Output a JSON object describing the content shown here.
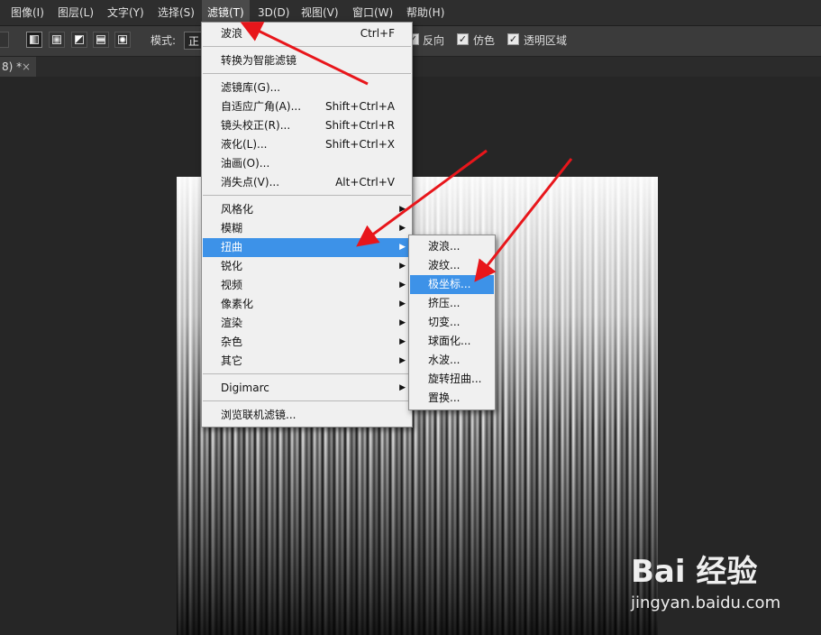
{
  "menubar": {
    "items": [
      "图像(I)",
      "图层(L)",
      "文字(Y)",
      "选择(S)",
      "滤镜(T)",
      "3D(D)",
      "视图(V)",
      "窗口(W)",
      "帮助(H)"
    ],
    "active_index": 4
  },
  "options": {
    "mode_label": "模式:",
    "mode_value": "正",
    "reverse_label": "反向",
    "dither_label": "仿色",
    "transparency_label": "透明区域"
  },
  "tab": {
    "title": "8) *",
    "close": "×"
  },
  "filter_menu": {
    "items": [
      {
        "label": "波浪",
        "shortcut": "Ctrl+F"
      },
      {
        "label": "转换为智能滤镜"
      },
      {
        "label": "滤镜库(G)..."
      },
      {
        "label": "自适应广角(A)...",
        "shortcut": "Shift+Ctrl+A"
      },
      {
        "label": "镜头校正(R)...",
        "shortcut": "Shift+Ctrl+R"
      },
      {
        "label": "液化(L)...",
        "shortcut": "Shift+Ctrl+X"
      },
      {
        "label": "油画(O)..."
      },
      {
        "label": "消失点(V)...",
        "shortcut": "Alt+Ctrl+V"
      },
      {
        "label": "风格化"
      },
      {
        "label": "模糊"
      },
      {
        "label": "扭曲"
      },
      {
        "label": "锐化"
      },
      {
        "label": "视频"
      },
      {
        "label": "像素化"
      },
      {
        "label": "渲染"
      },
      {
        "label": "杂色"
      },
      {
        "label": "其它"
      },
      {
        "label": "Digimarc"
      },
      {
        "label": "浏览联机滤镜..."
      }
    ],
    "highlighted_index": 10
  },
  "distort_submenu": {
    "items": [
      "波浪...",
      "波纹...",
      "极坐标...",
      "挤压...",
      "切变...",
      "球面化...",
      "水波...",
      "旋转扭曲...",
      "置换..."
    ],
    "highlighted_index": 2
  },
  "watermark": {
    "logo": "Bai 经验",
    "url": "jingyan.baidu.com"
  },
  "colors": {
    "highlight": "#3d92e8",
    "annotation_arrow": "#e8161b"
  }
}
